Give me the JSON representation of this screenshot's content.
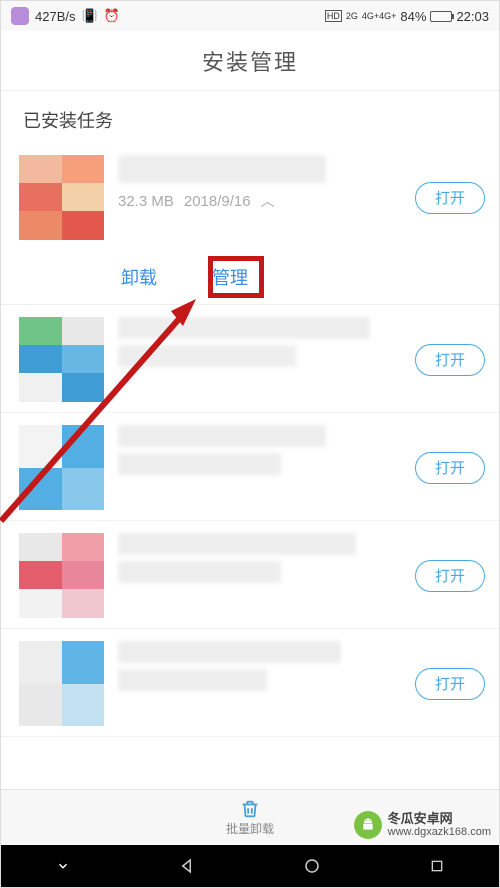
{
  "statusBar": {
    "speed": "427B/s",
    "signal2g": "2G",
    "signal4g": "4G+4G+",
    "hd": "HD",
    "battery": "84%",
    "time": "22:03"
  },
  "title": "安装管理",
  "sectionHeader": "已安装任务",
  "apps": [
    {
      "size": "32.3 MB",
      "date": "2018/9/16",
      "openLabel": "打开",
      "expanded": true
    },
    {
      "openLabel": "打开"
    },
    {
      "openLabel": "打开"
    },
    {
      "openLabel": "打开"
    },
    {
      "openLabel": "打开"
    }
  ],
  "actions": {
    "uninstall": "卸载",
    "manage": "管理"
  },
  "bottomBar": {
    "label": "批量卸载"
  },
  "watermark": {
    "line1": "冬瓜安卓网",
    "line2": "www.dgxazk168.com"
  }
}
